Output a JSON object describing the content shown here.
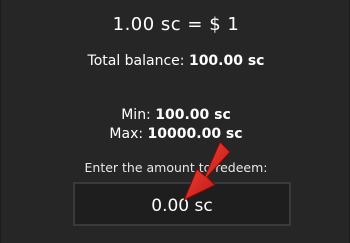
{
  "rate": {
    "text": "1.00 sc = $ 1"
  },
  "balance": {
    "label": "Total balance: ",
    "value": "100.00 sc"
  },
  "limits": {
    "min_label": "Min: ",
    "min_value": "100.00 sc",
    "max_label": "Max: ",
    "max_value": "10000.00 sc"
  },
  "redeem": {
    "prompt": "Enter the amount to redeem:",
    "value": "0.00 sc"
  },
  "colors": {
    "background": "#262626",
    "text": "#ffffff",
    "input_border": "#3a3a3a",
    "arrow": "#d41f1f"
  },
  "icons": {
    "pointer": "red-arrow-icon"
  }
}
